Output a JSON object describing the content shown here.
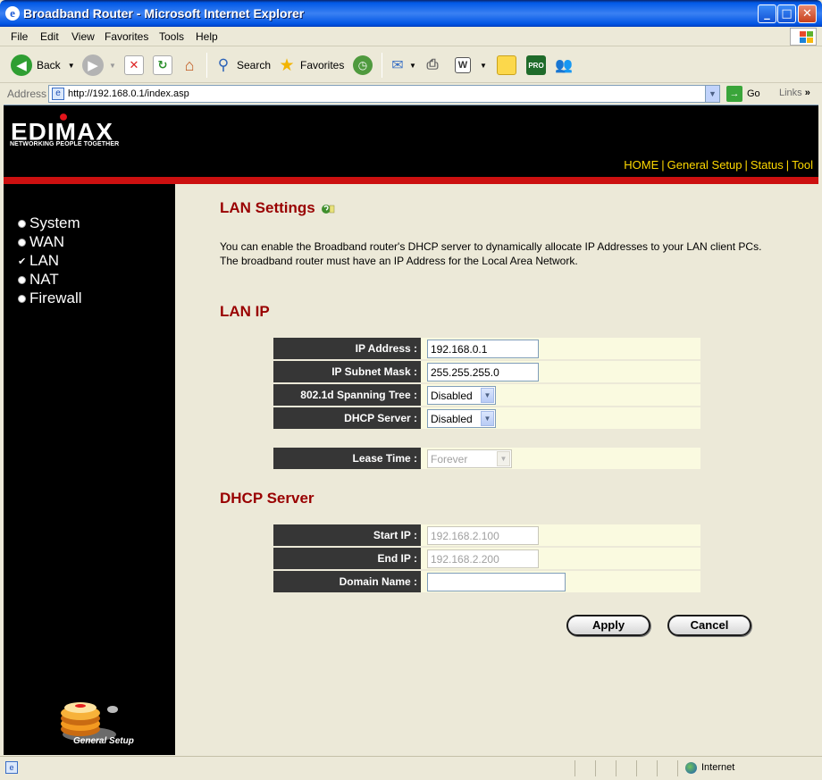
{
  "window": {
    "title": "Broadband Router - Microsoft Internet Explorer"
  },
  "menu": [
    "File",
    "Edit",
    "View",
    "Favorites",
    "Tools",
    "Help"
  ],
  "toolbar": {
    "back_label": "Back",
    "search_label": "Search",
    "favorites_label": "Favorites"
  },
  "address": {
    "label": "Address",
    "url": "http://192.168.0.1/index.asp",
    "go_label": "Go",
    "links_label": "Links"
  },
  "brand": {
    "logo": "EDIMAX",
    "tagline": "NETWORKING PEOPLE TOGETHER"
  },
  "topnav": [
    "HOME",
    "General Setup",
    "Status",
    "Tool"
  ],
  "sidebar": {
    "items": [
      {
        "label": "System",
        "selected": false
      },
      {
        "label": "WAN",
        "selected": false
      },
      {
        "label": "LAN",
        "selected": true
      },
      {
        "label": "NAT",
        "selected": false
      },
      {
        "label": "Firewall",
        "selected": false
      }
    ],
    "footer_label": "General Setup"
  },
  "page": {
    "title": "LAN Settings",
    "description": "You can enable the Broadband router's DHCP server to dynamically allocate IP Addresses to your LAN client PCs. The broadband router must have an IP Address for the Local Area Network.",
    "lan_ip_heading": "LAN IP",
    "dhcp_heading": "DHCP Server"
  },
  "lan_ip": {
    "ip_address": {
      "label": "IP Address :",
      "value": "192.168.0.1"
    },
    "subnet_mask": {
      "label": "IP Subnet Mask :",
      "value": "255.255.255.0"
    },
    "spanning_tree": {
      "label": "802.1d Spanning Tree :",
      "value": "Disabled"
    },
    "dhcp_server": {
      "label": "DHCP Server :",
      "value": "Disabled"
    }
  },
  "lease": {
    "label": "Lease Time :",
    "value": "Forever"
  },
  "dhcp": {
    "start_ip": {
      "label": "Start IP :",
      "value": "192.168.2.100"
    },
    "end_ip": {
      "label": "End IP :",
      "value": "192.168.2.200"
    },
    "domain_name": {
      "label": "Domain Name :",
      "value": ""
    }
  },
  "buttons": {
    "apply": "Apply",
    "cancel": "Cancel"
  },
  "status": {
    "zone": "Internet"
  },
  "colors": {
    "heading": "#990000",
    "nav": "#ffd900",
    "accent_bar": "#cc1010",
    "label_bg": "#363636",
    "row_bg": "#fafae0"
  }
}
